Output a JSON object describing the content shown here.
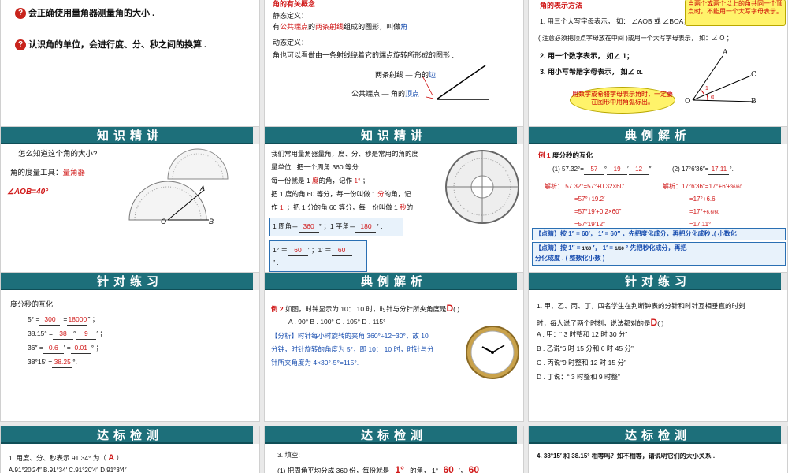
{
  "s1": {
    "line1": "会正确使用量角器测量角的大小 .",
    "line2": "认识角的单位，会进行度、分、秒之间的换算 ."
  },
  "s2": {
    "title": "角的有关概念",
    "static_label": "静态定义：",
    "static_def_a": "有",
    "static_def_b": "公共端点",
    "static_def_c": "的",
    "static_def_d": "两条射线",
    "static_def_e": "组成的图形，叫做",
    "static_def_f": "角",
    "dynamic_label": "动态定义：",
    "dynamic_def": "角也可以看做由一条射线绕着它的端点旋转所形成的图形 .",
    "sides_label": "两条射线 — 角的",
    "sides_word": "边",
    "vertex_label": "公共端点 — 角的",
    "vertex_word": "顶点"
  },
  "s3": {
    "title": "角的表示方法",
    "m1": "1. 用三个大写字母表示，  如：  ∠AOB 或 ∠BOA；",
    "note": "( 注意必须把顶点字母放在中间 )",
    "note2": "或用一个大写字母表示，  如：∠ O ；",
    "m2": "2.  用一个数字表示，   如∠ 1；",
    "m3": "3.  用小写希腊字母表示，  如∠ α.",
    "callout1": "当两个或两个以上的角共同一个顶点时，不能用一个大写字母表示。",
    "callout2": "用数字或希腊字母表示角时，一定要在图形中用角弧标出。",
    "pA": "A",
    "pC": "C",
    "pO": "O",
    "pB": "B",
    "p1": "1",
    "pa": "α"
  },
  "s4": {
    "bar": "知识精讲",
    "q": "怎么知道这个角的大小?",
    "tool_label": "角的度量工具：",
    "tool": "量角器",
    "aob": "∠AOB=40°",
    "pA": "A",
    "pO": "O",
    "pB": "B"
  },
  "s5": {
    "bar": "知识精讲",
    "p1": "我们常用量角器量角，度、分、秒是常用的角的度",
    "p2": "量单位 . 把一个周角   360 等分 .",
    "p3a": "每一份就是   1  ",
    "p3b": "度",
    "p3c": "的角，记作  ",
    "p3d": "1°",
    "p3e": " ；",
    "p4a": "把   1 度的角   60  等分，每一份叫做 1  ",
    "p4b": "分",
    "p4c": "的角，记",
    "p5a": "作   ",
    "p5b": "1′",
    "p5c": " ；把 1 分的角   60 等分，每一份叫做 1  ",
    "p5d": "秒",
    "p5e": "的",
    "f1a": "1 周角＝",
    "f1v": "360",
    "f1b": "° ；1 平角＝",
    "f1v2": "180",
    "f1c": "° .",
    "f2a": "1° ＝",
    "f2v": "60",
    "f2b": "′ ；1′ ＝",
    "f2v2": "60",
    "f2c": "″ ."
  },
  "s6": {
    "bar": "典例解析",
    "ex_label": "例 1",
    "ex_title": "度分秒的互化",
    "q1a": "(1) 57.32°=",
    "q1v1": "57",
    "q1b": "°",
    "q1v2": "19",
    "q1c": "′",
    "q1v3": "12",
    "q1d": "″",
    "q2a": "(2) 17°6′36″=",
    "q2v": "17.11",
    "q2b": "°.",
    "sol1_label": "解析：",
    "sol1_l1": "57.32°=57°+0.32×60′",
    "sol1_l2": "=57°+19.2′",
    "sol1_l3": "=57°19′+0.2×60″",
    "sol1_l4": "=57°19′12″",
    "sol2_label": "解析：",
    "sol2_l1": "17°6′36″=17°+6′+",
    "sol2_f": "36/60",
    "sol2_l2": "=17°+6.6′",
    "sol2_l3": "=17°+",
    "sol2_f2": "6.6/60",
    "sol2_l4": "=17.11°",
    "tip1a": "【点睛】按 1° = 60′， 1′ = 60″ ，先把度化成分，再把分化成秒 .",
    "tip1b": "( 小数化",
    "tip2a": "【点睛】按 1″ =",
    "tip2f": "1/60",
    "tip2b": "′， 1′ =",
    "tip2f2": "1/60",
    "tip2c": "° 先把秒化成分，再把",
    "tip3": "分化成度 . ( 整数化小数 )"
  },
  "s7": {
    "bar": "针对练习",
    "title": "度分秒的互化",
    "r1a": "5° =",
    "r1v": "300",
    "r1b": "′ =",
    "r1v2": "18000",
    "r1c": "″ ；",
    "r2a": "38.15° =",
    "r2v": "38",
    "r2b": "°",
    "r2v2": "9",
    "r2c": "′ ；",
    "r3a": "36″ =",
    "r3v": "0.6",
    "r3b": "′ =",
    "r3v2": "0.01",
    "r3c": "° ；",
    "r4a": "38°15′ =",
    "r4v": "38.25",
    "r4b": "°."
  },
  "s8": {
    "bar": "典例解析",
    "q_label": "例 2",
    "q": "如图，时钟显示为 10： 10 时，时针与分针所夹角度是",
    "ans": "D",
    "paren": "(         )",
    "opts": "A .  90°       B .  100°       C .  105°       D .  115°",
    "an1": "【分析】时针每小时旋转的夹角 360°÷12=30°，故 10",
    "an2": "分钟，时针旋转的角度为 5°，即 10： 10 时，时针与分",
    "an3": "针所夹角度为 4×30°-5°=115°."
  },
  "s9": {
    "bar": "针对练习",
    "q1": "1. 甲、乙、丙、丁，四名学生在判断钟表的分针和时针互相垂直的时刻",
    "q2": "时，每人说了两个时刻，说法都对的是",
    "ans": "D",
    "paren": "(        )",
    "oA": "A .  甲：“ 3 时整和 12 时 30 分”",
    "oB": "B .  乙说“6 时 15 分和 6 时 45 分”",
    "oC": "C .  丙说“9 时整和 12 时 15 分”",
    "oD": "D .  丁说：“ 3 时整和 9 时整”"
  },
  "s10": {
    "bar": "达标检测",
    "q": "1. 用度、分、秒表示 91.34° 为（",
    "ans": "A",
    "qend": "）",
    "opts": "A.91°20′24″          B.91°34′          C.91°20′4″          D.91°3′4″"
  },
  "s11": {
    "bar": "达标检测",
    "q": "3. 填空:",
    "l1a": "(1) 把周角平均分成 360 份，每份就是",
    "l1v": "1°",
    "l1b": "的角， 1°",
    "l1v2": "60",
    "l1c": "′，",
    "l1v3": "60"
  },
  "s12": {
    "bar": "达标检测",
    "q": "4. 38°15′ 和 38.15° 相等吗？如不相等，请说明它们的大小关系 ."
  }
}
